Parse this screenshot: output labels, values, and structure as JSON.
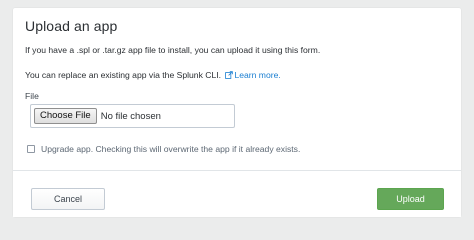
{
  "dialog": {
    "title": "Upload an app",
    "instruction": "If you have a .spl or .tar.gz app file to install, you can upload it using this form.",
    "cli_text": "You can replace an existing app via the Splunk CLI.",
    "learn_more": "Learn more.",
    "file_label": "File",
    "choose_file": "Choose File",
    "no_file": "No file chosen",
    "upgrade_text": "Upgrade app. Checking this will overwrite the app if it already exists.",
    "upgrade_checked": false
  },
  "footer": {
    "cancel_label": "Cancel",
    "upload_label": "Upload"
  },
  "colors": {
    "link": "#1a7ed1",
    "primary": "#65a85a"
  },
  "icons": {
    "learn_more": "external-link-icon"
  }
}
